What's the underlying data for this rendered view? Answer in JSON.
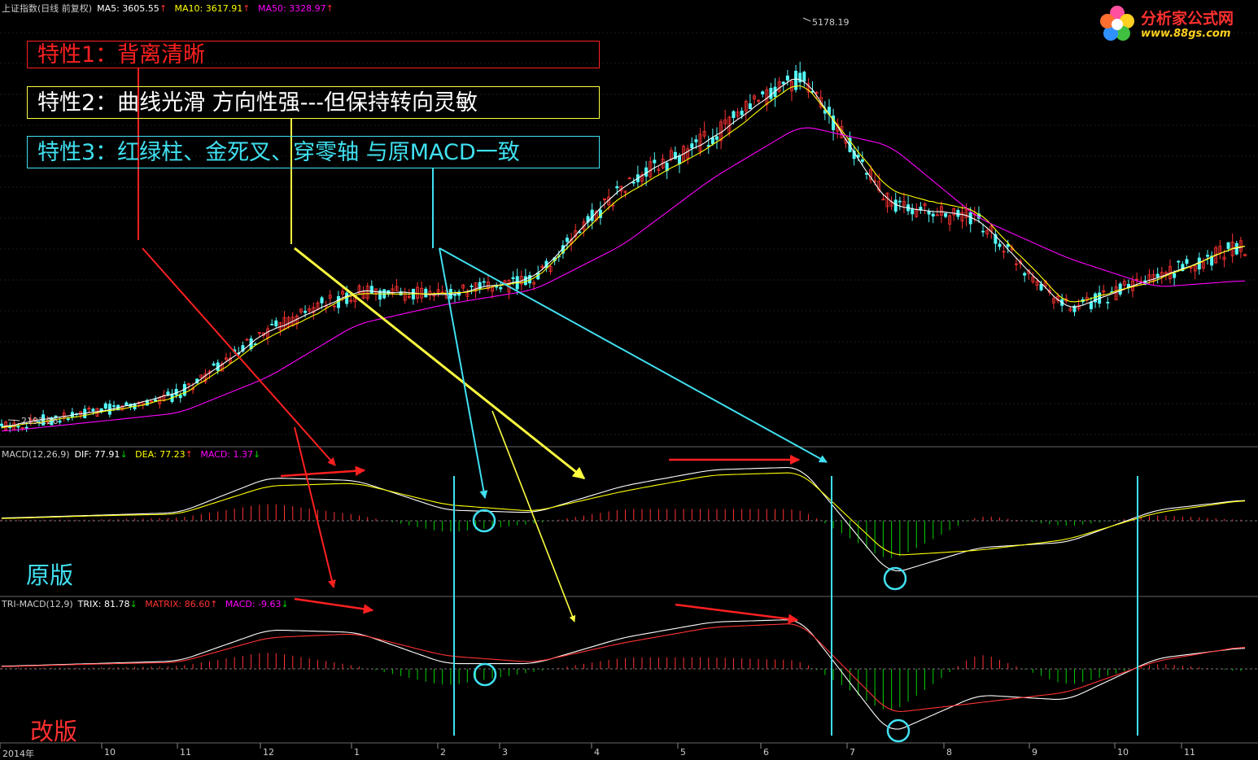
{
  "header": {
    "title": "上证指数(日线 前复权)",
    "ma5": "MA5: 3605.55",
    "ma10": "MA10: 3617.91",
    "ma50": "MA50: 3328.97",
    "up_arrow": "↑"
  },
  "macd_header": {
    "name": "MACD(12,26,9)",
    "dif": "DIF: 77.91",
    "dea": "DEA: 77.23",
    "macd": "MACD: 1.37",
    "down_arrow": "↓",
    "up_arrow": "↑"
  },
  "trimacd_header": {
    "name": "TRI-MACD(12,9)",
    "trix": "TRIX: 81.78",
    "matrix": "MATRIX: 86.60",
    "macd": "MACD: -9.63",
    "down_arrow": "↓",
    "up_arrow": "↑"
  },
  "annotations": {
    "feature1": "特性1：背离清晰",
    "feature2": "特性2：曲线光滑 方向性强---但保持转向灵敏",
    "feature3": "特性3：红绿柱、金死叉、穿零轴 与原MACD一致"
  },
  "labels": {
    "original": "原版",
    "revised": "改版",
    "high_value": "5178.19",
    "low_value": "2193.26"
  },
  "logo": {
    "name": "分析家公式网",
    "url": "www.88gs.com"
  },
  "x_axis": [
    "2014年",
    "10",
    "11",
    "12",
    "1",
    "2",
    "3",
    "4",
    "5",
    "6",
    "7",
    "8",
    "9",
    "10",
    "11"
  ],
  "colors": {
    "background": "#000000",
    "up": "#ff3232",
    "down": "#54fcfc",
    "ma5": "#ffffff",
    "ma10": "#ffff00",
    "ma50": "#ff00ff",
    "histogram_up": "#ff3232",
    "histogram_down": "#00d000",
    "feature1": "#ff2020",
    "feature2": "#ffff40",
    "feature3": "#40e0f0"
  },
  "chart_data": [
    {
      "type": "line",
      "title": "上证指数(日线 前复权)",
      "x": [
        "2014-09",
        "2014-10",
        "2014-11",
        "2014-12",
        "2015-01",
        "2015-02",
        "2015-03",
        "2015-04",
        "2015-05",
        "2015-06",
        "2015-07",
        "2015-08",
        "2015-09",
        "2015-10",
        "2015-11"
      ],
      "series": [
        {
          "name": "MA5",
          "values": [
            2230,
            2330,
            2470,
            2950,
            3250,
            3220,
            3350,
            4050,
            4400,
            4900,
            3900,
            3800,
            3100,
            3350,
            3600
          ]
        },
        {
          "name": "MA10",
          "values": [
            2225,
            2320,
            2450,
            2900,
            3230,
            3230,
            3330,
            3980,
            4350,
            4850,
            4000,
            3850,
            3150,
            3330,
            3610
          ]
        },
        {
          "name": "MA50",
          "values": [
            2190,
            2260,
            2330,
            2600,
            3000,
            3150,
            3260,
            3600,
            4100,
            4500,
            4350,
            3800,
            3500,
            3280,
            3330
          ]
        }
      ],
      "annotations": [
        "5178.19",
        "2193.26"
      ]
    },
    {
      "type": "bar",
      "title": "MACD(12,26,9)",
      "series": [
        {
          "name": "DIF",
          "values": [
            10,
            20,
            30,
            160,
            150,
            40,
            30,
            130,
            190,
            200,
            -200,
            -100,
            -80,
            40,
            78
          ]
        },
        {
          "name": "DEA",
          "values": [
            8,
            18,
            25,
            130,
            140,
            60,
            35,
            110,
            170,
            180,
            -130,
            -110,
            -70,
            30,
            77
          ]
        }
      ]
    },
    {
      "type": "bar",
      "title": "TRI-MACD(12,9)",
      "series": [
        {
          "name": "TRIX",
          "values": [
            10,
            20,
            30,
            150,
            140,
            20,
            20,
            120,
            180,
            190,
            -250,
            -100,
            -120,
            40,
            82
          ]
        },
        {
          "name": "MATRIX",
          "values": [
            8,
            18,
            25,
            120,
            135,
            50,
            25,
            100,
            160,
            175,
            -170,
            -130,
            -90,
            30,
            87
          ]
        }
      ]
    }
  ]
}
